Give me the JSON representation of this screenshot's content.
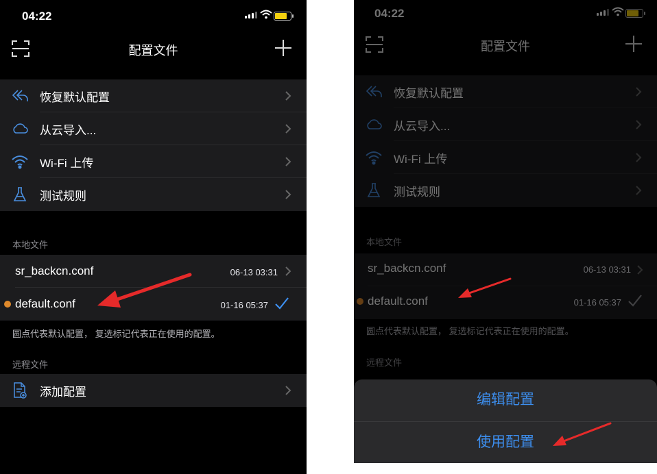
{
  "status_bar": {
    "time": "04:22"
  },
  "nav": {
    "title": "配置文件"
  },
  "menu": [
    {
      "label": "恢复默认配置",
      "icon": "restore-icon"
    },
    {
      "label": "从云导入...",
      "icon": "cloud-icon"
    },
    {
      "label": "Wi-Fi 上传",
      "icon": "wifi-icon"
    },
    {
      "label": "测试规则",
      "icon": "test-icon"
    }
  ],
  "local_section": {
    "header": "本地文件"
  },
  "files": [
    {
      "name": "sr_backcn.conf",
      "date": "06-13 03:31",
      "is_default": false,
      "in_use": false
    },
    {
      "name": "default.conf",
      "date": "01-16 05:37",
      "is_default": true,
      "in_use": true
    }
  ],
  "legend_note": "圆点代表默认配置， 复选标记代表正在使用的配置。",
  "remote_section": {
    "header": "远程文件",
    "add_label": "添加配置"
  },
  "action_sheet": {
    "options": [
      "编辑配置",
      "使用配置"
    ]
  },
  "colors": {
    "accent": "#3d8ff0",
    "dot": "#e08a2c",
    "annotation": "#e62a2a",
    "row_bg": "#1c1c1e"
  }
}
